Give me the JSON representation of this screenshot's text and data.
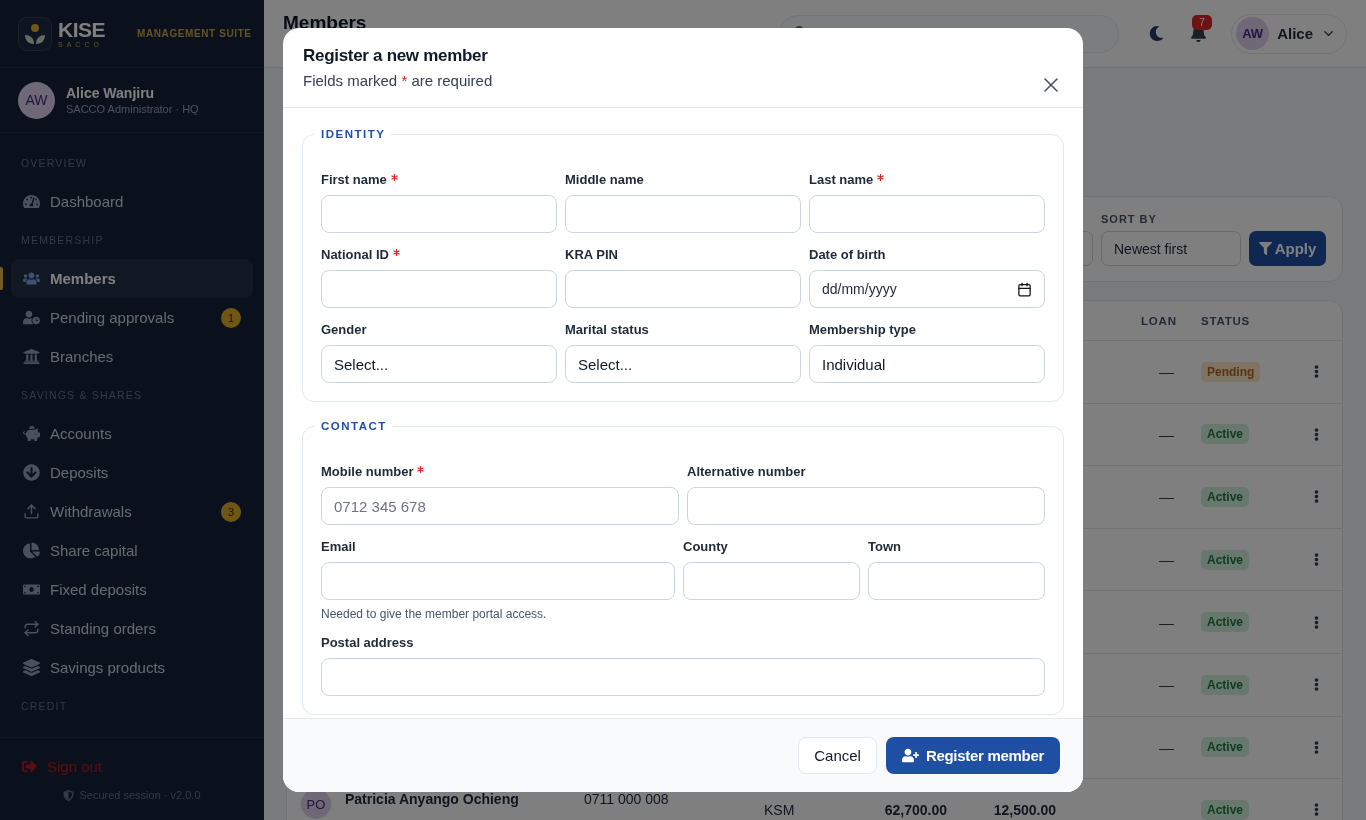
{
  "sidebar": {
    "brand": {
      "name": "KISE",
      "tagline": "SACCO",
      "suite": "MANAGEMENT SUITE"
    },
    "user": {
      "initials": "AW",
      "name": "Alice Wanjiru",
      "role": "SACCO Administrator · HQ"
    },
    "sections": [
      {
        "title": "OVERVIEW",
        "items": [
          {
            "label": "Dashboard",
            "selected": false
          }
        ]
      },
      {
        "title": "MEMBERSHIP",
        "items": [
          {
            "label": "Members",
            "selected": true
          },
          {
            "label": "Pending approvals",
            "selected": false,
            "badge": "1"
          },
          {
            "label": "Branches",
            "selected": false
          }
        ]
      },
      {
        "title": "SAVINGS & SHARES",
        "items": [
          {
            "label": "Accounts",
            "selected": false
          },
          {
            "label": "Deposits",
            "selected": false
          },
          {
            "label": "Withdrawals",
            "selected": false,
            "badge": "3"
          },
          {
            "label": "Share capital",
            "selected": false
          },
          {
            "label": "Fixed deposits",
            "selected": false
          },
          {
            "label": "Standing orders",
            "selected": false
          },
          {
            "label": "Savings products",
            "selected": false
          }
        ]
      },
      {
        "title": "CREDIT"
      }
    ],
    "sign_out": "Sign out",
    "session": "Secured session · v2.0.0"
  },
  "topbar": {
    "title": "Members",
    "notifications": "7",
    "user": {
      "initials": "AW",
      "name": "Alice"
    }
  },
  "filters": {
    "sort_label": "SORT BY",
    "sort_value": "Newest first",
    "apply": "Apply"
  },
  "table": {
    "columns": [
      "LOAN",
      "STATUS"
    ],
    "rows": [
      {
        "loan": "—",
        "status": "Pending",
        "kind": "pending"
      },
      {
        "loan": "—",
        "status": "Active",
        "kind": "active"
      },
      {
        "loan": "—",
        "status": "Active",
        "kind": "active"
      },
      {
        "loan": "—",
        "status": "Active",
        "kind": "active"
      },
      {
        "loan": "—",
        "status": "Active",
        "kind": "active"
      },
      {
        "loan": "—",
        "status": "Active",
        "kind": "active"
      },
      {
        "loan": "—",
        "status": "Active",
        "kind": "active"
      },
      {
        "initials": "PO",
        "name": "Patricia Anyango Ochieng",
        "phone": "0711 000 008",
        "column_3": "KSM",
        "column_4": "62,700.00",
        "column_5": "12,500.00",
        "status": "Active",
        "kind": "active"
      }
    ]
  },
  "modal": {
    "title": "Register a new member",
    "subtitle": {
      "before": "Fields marked",
      "mark": "*",
      "after": "are required"
    },
    "sections": [
      {
        "legend": "IDENTITY",
        "fields": [
          {
            "label": "First name",
            "required": true,
            "kind": "text"
          },
          {
            "label": "Middle name",
            "required": false,
            "kind": "text"
          },
          {
            "label": "Last name",
            "required": true,
            "kind": "text"
          },
          {
            "label": "National ID",
            "required": true,
            "kind": "text"
          },
          {
            "label": "KRA PIN",
            "required": false,
            "kind": "text"
          },
          {
            "label": "Date of birth",
            "required": false,
            "kind": "date",
            "placeholder": "dd/mm/yyyy"
          },
          {
            "label": "Gender",
            "required": false,
            "kind": "select",
            "value": "Select..."
          },
          {
            "label": "Marital status",
            "required": false,
            "kind": "select",
            "value": "Select..."
          },
          {
            "label": "Membership type",
            "required": false,
            "kind": "select",
            "value": "Individual"
          }
        ]
      },
      {
        "legend": "CONTACT",
        "rows": [
          [
            {
              "label": "Mobile number",
              "required": true,
              "kind": "text",
              "placeholder": "0712 345 678"
            },
            {
              "label": "Alternative number",
              "required": false,
              "kind": "text"
            }
          ],
          [
            {
              "label": "Email",
              "required": false,
              "kind": "text",
              "hint": "Needed to give the member portal access."
            },
            {
              "label": "County",
              "required": false,
              "kind": "text"
            },
            {
              "label": "Town",
              "required": false,
              "kind": "text"
            }
          ],
          [
            {
              "label": "Postal address",
              "required": false,
              "kind": "text"
            }
          ]
        ]
      }
    ],
    "buttons": {
      "cancel": "Cancel",
      "submit": "Register member"
    }
  }
}
